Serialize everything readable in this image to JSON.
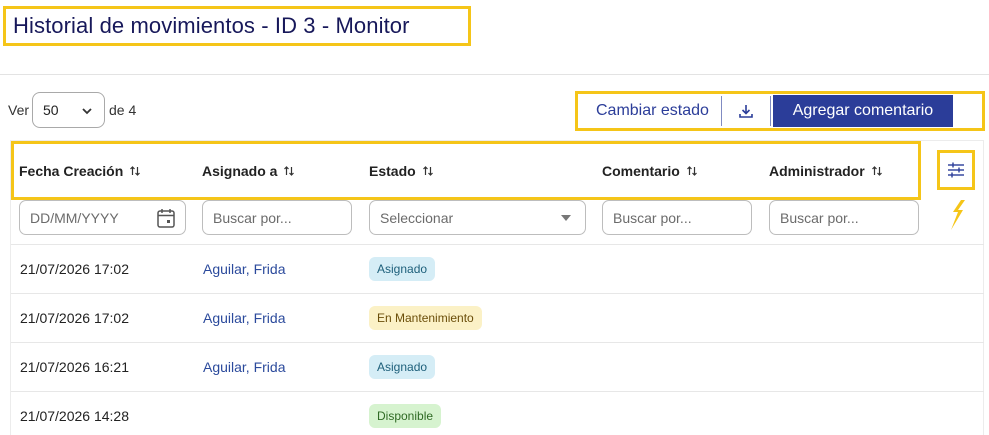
{
  "page": {
    "title": "Historial de movimientos - ID 3 - Monitor"
  },
  "pager": {
    "ver_label": "Ver",
    "page_size": "50",
    "of_label": "de 4"
  },
  "actions": {
    "change_state": "Cambiar estado",
    "download_icon": "download-icon",
    "add_comment": "Agregar comentario"
  },
  "table": {
    "columns": [
      {
        "label": "Fecha Creación"
      },
      {
        "label": "Asignado a"
      },
      {
        "label": "Estado"
      },
      {
        "label": "Comentario"
      },
      {
        "label": "Administrador"
      }
    ],
    "filters": {
      "date_placeholder": "DD/MM/YYYY",
      "assigned_placeholder": "Buscar por...",
      "state_placeholder": "Seleccionar",
      "comment_placeholder": "Buscar por...",
      "admin_placeholder": "Buscar por..."
    },
    "rows": [
      {
        "date": "21/07/2026 17:02",
        "assigned": "Aguilar, Frida",
        "state": "Asignado",
        "state_color": "#d5edf6"
      },
      {
        "date": "21/07/2026 17:02",
        "assigned": "Aguilar, Frida",
        "state": "En Mantenimiento",
        "state_color": "#fbf1c6"
      },
      {
        "date": "21/07/2026 16:21",
        "assigned": "Aguilar, Frida",
        "state": "Asignado",
        "state_color": "#d5edf6"
      },
      {
        "date": "21/07/2026 14:28",
        "assigned": "",
        "state": "Disponible",
        "state_color": "#d6f3cf"
      }
    ]
  },
  "colors": {
    "accent": "#2b3d99",
    "highlight": "#f5c518",
    "title": "#17185a"
  }
}
